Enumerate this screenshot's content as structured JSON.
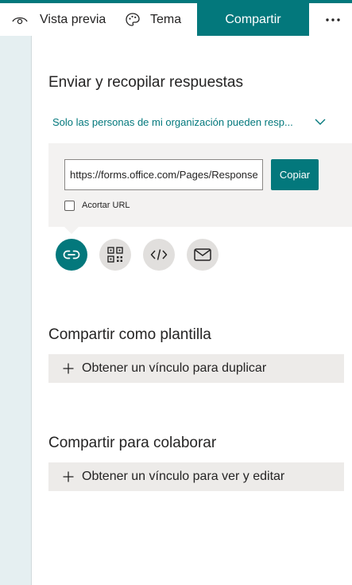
{
  "toolbar": {
    "preview_label": "Vista previa",
    "preview_icon": "eye-icon",
    "theme_label": "Tema",
    "theme_icon": "palette-icon",
    "share_label": "Compartir",
    "more_icon": "more-ellipsis-icon",
    "accent_color": "#03787c"
  },
  "send_section": {
    "title": "Enviar y recopilar respuestas",
    "permission_label": "Solo las personas de mi organización pueden resp...",
    "url_value": "https://forms.office.com/Pages/ResponsePage.aspx",
    "copy_label": "Copiar",
    "shorten_label": "Acortar URL",
    "shorten_checked": false,
    "share_methods": [
      {
        "icon": "link-icon",
        "selected": true
      },
      {
        "icon": "qr-code-icon",
        "selected": false
      },
      {
        "icon": "embed-code-icon",
        "selected": false
      },
      {
        "icon": "email-icon",
        "selected": false
      }
    ]
  },
  "template_section": {
    "title": "Compartir como plantilla",
    "action_label": "Obtener un vínculo para duplicar",
    "action_icon": "plus-icon"
  },
  "collab_section": {
    "title": "Compartir para colaborar",
    "action_label": "Obtener un vínculo para ver y editar",
    "action_icon": "plus-icon"
  }
}
